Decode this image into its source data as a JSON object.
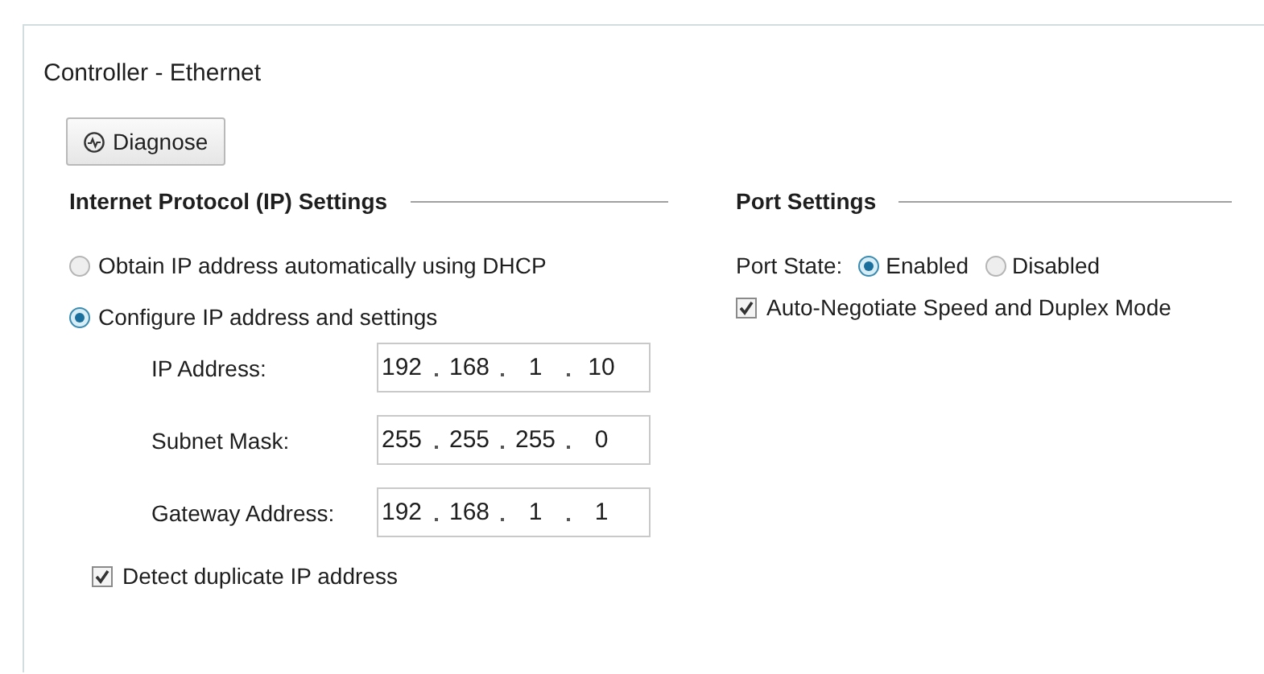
{
  "panel": {
    "title": "Controller - Ethernet"
  },
  "diagnose_button": {
    "label": "Diagnose"
  },
  "ip_settings": {
    "heading": "Internet Protocol (IP) Settings",
    "options": [
      {
        "label": "Obtain IP address automatically using DHCP",
        "selected": false
      },
      {
        "label": "Configure IP address and settings",
        "selected": true
      }
    ],
    "fields": [
      {
        "label": "IP Address:",
        "octets": [
          "192",
          "168",
          "1",
          "10"
        ]
      },
      {
        "label": "Subnet Mask:",
        "octets": [
          "255",
          "255",
          "255",
          "0"
        ]
      },
      {
        "label": "Gateway Address:",
        "octets": [
          "192",
          "168",
          "1",
          "1"
        ]
      }
    ],
    "detect_duplicate": {
      "label": "Detect duplicate IP address",
      "checked": true
    }
  },
  "port_settings": {
    "heading": "Port Settings",
    "state_label": "Port State:",
    "states": [
      {
        "label": "Enabled",
        "selected": true
      },
      {
        "label": "Disabled",
        "selected": false
      }
    ],
    "auto_negotiate": {
      "label": "Auto-Negotiate Speed and Duplex Mode",
      "checked": true
    }
  }
}
